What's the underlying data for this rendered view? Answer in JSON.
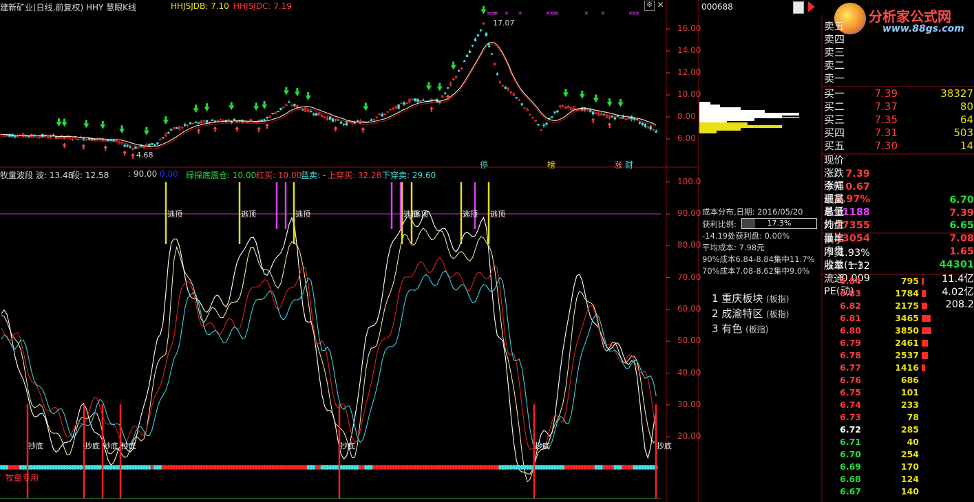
{
  "upper": {
    "stock_title": "建新矿业(日线,前复权) HHY 慧眼K线",
    "ind1": "HHJSJDB: 7.10",
    "ind2": "HHJSJDC: 7.19",
    "price_axis": [
      "16.00",
      "14.00",
      "12.00",
      "10.00",
      "8.00",
      "6.00"
    ],
    "peak_label": "17.07",
    "low_label": "4.68",
    "markers": [
      "停",
      "榜",
      "涨",
      "财"
    ]
  },
  "lower": {
    "h_title": "牧童波段",
    "h_bo": "波: 13.48",
    "h_duan": "段: 12.58",
    "h_90": ": 90.00",
    "h_0": "0.00",
    "h_green": "绿探底震仓: 10.00",
    "h_red": "红买: 10.00",
    "h_blue": "蓝卖: -",
    "h_up": "上穿买: 32.28",
    "h_down": "下穿卖: 29.60",
    "axis": [
      "100.0",
      "90.00",
      "80.00",
      "70.00",
      "60.00",
      "50.00",
      "40.00",
      "30.00",
      "20.00"
    ],
    "top_label": "逃顶",
    "bottom_label": "抄底",
    "footer": "牧童专用"
  },
  "right": {
    "code": "000688",
    "logo_text": "分析家公式网",
    "logo_url": "www.88gs.com",
    "sell": [
      {
        "label": "卖五",
        "price": "",
        "vol": ""
      },
      {
        "label": "卖四",
        "price": "",
        "vol": ""
      },
      {
        "label": "卖三",
        "price": "",
        "vol": ""
      },
      {
        "label": "卖二",
        "price": "",
        "vol": ""
      },
      {
        "label": "卖一",
        "price": "",
        "vol": ""
      }
    ],
    "buy": [
      {
        "label": "买一",
        "price": "7.39",
        "vol": "38327"
      },
      {
        "label": "买二",
        "price": "7.37",
        "vol": "80"
      },
      {
        "label": "买三",
        "price": "7.35",
        "vol": "64"
      },
      {
        "label": "买四",
        "price": "7.31",
        "vol": "503"
      },
      {
        "label": "买五",
        "price": "7.30",
        "vol": "14"
      }
    ],
    "stats": [
      {
        "l1": "现价",
        "v1": "7.39",
        "l2": "今开",
        "v2": "6.70"
      },
      {
        "l1": "涨跌",
        "v1": "0.67",
        "l2": "最高",
        "v2": "7.39"
      },
      {
        "l1": "涨幅",
        "v1": "9.97%",
        "l2": "最低",
        "v2": "6.65"
      },
      {
        "l1": "现量",
        "v1": "1188",
        "l2": "均价",
        "v2": "7.08"
      },
      {
        "l1": "总量",
        "v1": "77355",
        "l2": "量比",
        "v2": "1.65"
      },
      {
        "l1": "外盘",
        "v1": "33054",
        "l2": "内盘",
        "v2": "44301"
      }
    ],
    "stats2": [
      {
        "l1": "换手",
        "v1": "1.93%",
        "l2": "股本",
        "v2": "11.4亿"
      },
      {
        "l1": "净资",
        "v1": "1.32",
        "l2": "流通",
        "v2": "4.02亿"
      },
      {
        "l1": "收益(一)",
        "v1": "0.009",
        "l2": "PE(动)",
        "v2": "208.2"
      }
    ],
    "price_levels": [
      {
        "p": "6.84",
        "v": "795"
      },
      {
        "p": "6.83",
        "v": "1784"
      },
      {
        "p": "6.82",
        "v": "2175"
      },
      {
        "p": "6.81",
        "v": "3465"
      },
      {
        "p": "6.80",
        "v": "3850"
      },
      {
        "p": "6.79",
        "v": "2461"
      },
      {
        "p": "6.78",
        "v": "2537"
      },
      {
        "p": "6.77",
        "v": "1416"
      },
      {
        "p": "6.76",
        "v": "686"
      },
      {
        "p": "6.75",
        "v": "101"
      },
      {
        "p": "6.74",
        "v": "233"
      },
      {
        "p": "6.73",
        "v": "78"
      },
      {
        "p": "6.72",
        "v": "285"
      },
      {
        "p": "6.71",
        "v": "40"
      },
      {
        "p": "6.70",
        "v": "254"
      },
      {
        "p": "6.69",
        "v": "170"
      },
      {
        "p": "6.68",
        "v": "124"
      },
      {
        "p": "6.67",
        "v": "140"
      }
    ],
    "cost": {
      "date": "成本分布,日期: 2016/05/20",
      "ratio_label": "获利比例:",
      "ratio_value": "17.3%",
      "profit": "-14.19处获利盘: 0.00%",
      "avg": "平均成本: 7.98元",
      "c90": "90%成本6.84-8.84集中11.7%",
      "c70": "70%成本7.08-8.62集中9.0%"
    },
    "blocks": [
      {
        "n": "1",
        "name": "重庆板块",
        "tag": "(板指)"
      },
      {
        "n": "2",
        "name": "成渝特区",
        "tag": "(板指)"
      },
      {
        "n": "3",
        "name": "有色",
        "tag": "(板指)"
      }
    ]
  }
}
